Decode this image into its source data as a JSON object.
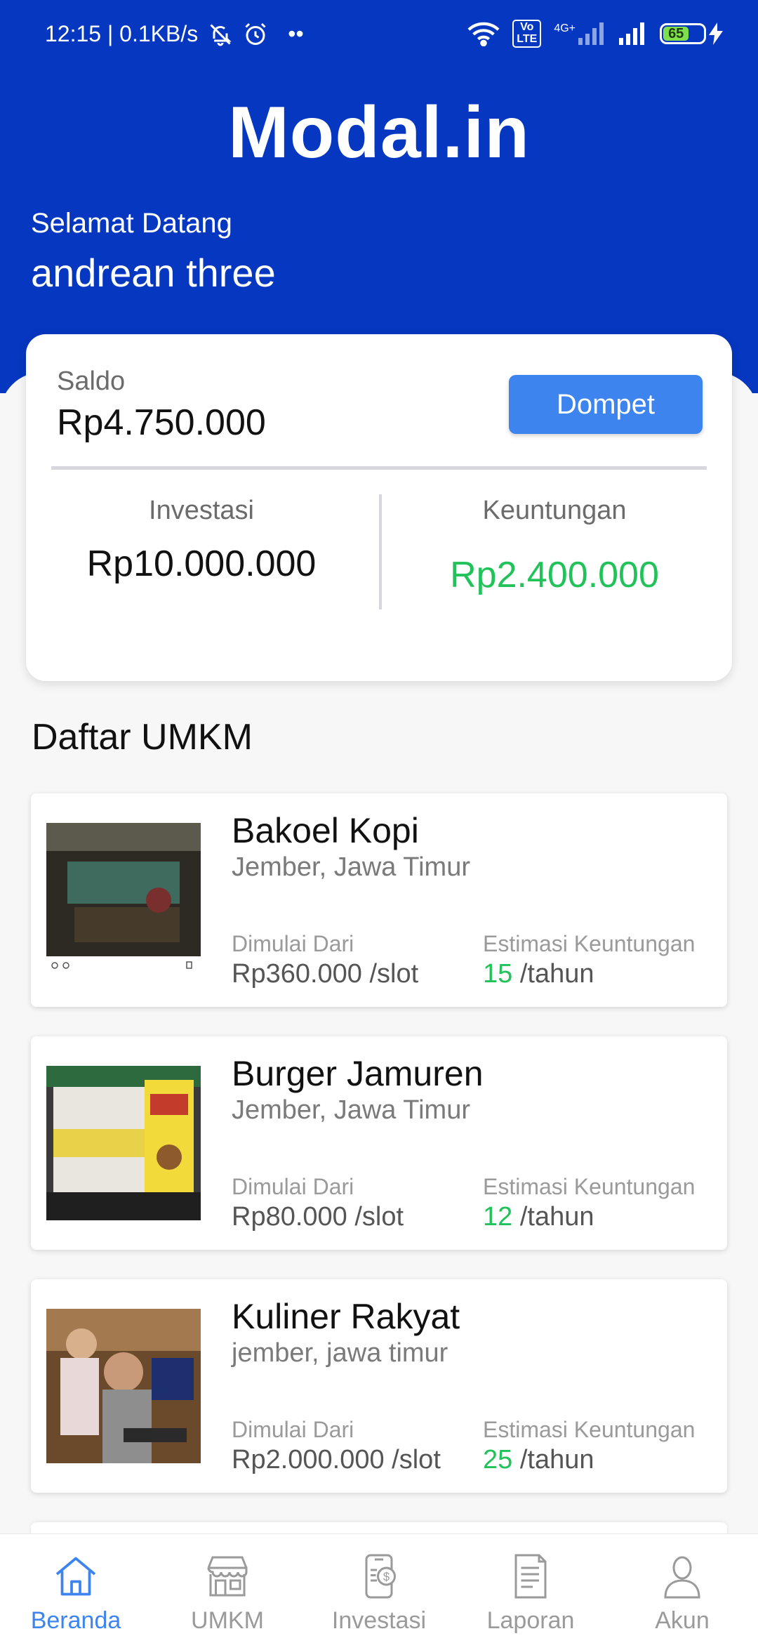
{
  "status_bar": {
    "time_speed": "12:15 | 0.1KB/s",
    "dots": "••",
    "lte_badge_top": "Vo",
    "lte_badge_bottom": "LTE",
    "network_label": "4G+",
    "battery_level": "65",
    "icons": [
      "mute-bell-icon",
      "alarm-icon",
      "wifi-icon",
      "signal-icon",
      "charging-icon"
    ]
  },
  "header": {
    "app_title": "Modal.in",
    "welcome": "Selamat Datang",
    "username": "andrean three"
  },
  "balance_card": {
    "saldo_label": "Saldo",
    "saldo_value": "Rp4.750.000",
    "dompet_label": "Dompet",
    "investasi_label": "Investasi",
    "investasi_value": "Rp10.000.000",
    "keuntungan_label": "Keuntungan",
    "keuntungan_value": "Rp2.400.000"
  },
  "umkm_section": {
    "title": "Daftar UMKM",
    "start_label": "Dimulai Dari",
    "estimate_label": "Estimasi Keuntungan",
    "per_year": " /tahun",
    "items": [
      {
        "name": "Bakoel Kopi",
        "location": "Jember, Jawa Timur",
        "start_price": "Rp360.000 /slot",
        "estimate": "15"
      },
      {
        "name": "Burger Jamuren",
        "location": "Jember, Jawa Timur",
        "start_price": "Rp80.000 /slot",
        "estimate": "12"
      },
      {
        "name": "Kuliner Rakyat",
        "location": "jember, jawa timur",
        "start_price": "Rp2.000.000 /slot",
        "estimate": "25"
      }
    ]
  },
  "bottom_nav": {
    "items": [
      {
        "label": "Beranda",
        "icon": "home-icon",
        "active": true
      },
      {
        "label": "UMKM",
        "icon": "store-icon",
        "active": false
      },
      {
        "label": "Investasi",
        "icon": "investment-phone-icon",
        "active": false
      },
      {
        "label": "Laporan",
        "icon": "report-icon",
        "active": false
      },
      {
        "label": "Akun",
        "icon": "account-icon",
        "active": false
      }
    ]
  },
  "colors": {
    "primary": "#0537c0",
    "button": "#3d84ef",
    "profit_green": "#22c25a"
  }
}
